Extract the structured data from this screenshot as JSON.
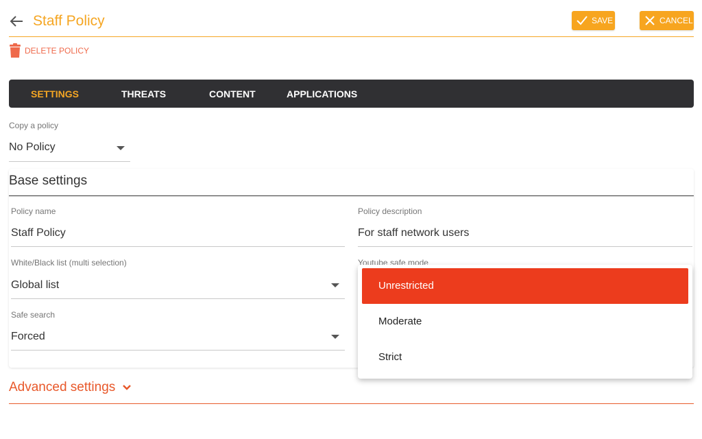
{
  "header": {
    "title": "Staff Policy",
    "save_label": "SAVE",
    "cancel_label": "CANCEL",
    "back_icon": "arrow-left-icon"
  },
  "actions": {
    "delete_label": "DELETE POLICY",
    "delete_icon": "trash-icon"
  },
  "tabs": [
    {
      "label": "SETTINGS",
      "active": true
    },
    {
      "label": "THREATS",
      "active": false
    },
    {
      "label": "CONTENT",
      "active": false
    },
    {
      "label": "APPLICATIONS",
      "active": false
    }
  ],
  "copy_policy": {
    "label": "Copy a policy",
    "value": "No Policy"
  },
  "base_settings": {
    "title": "Base settings",
    "policy_name": {
      "label": "Policy name",
      "value": "Staff Policy"
    },
    "policy_description": {
      "label": "Policy description",
      "value": "For staff network users"
    },
    "white_black_list": {
      "label": "White/Black list (multi selection)",
      "value": "Global list"
    },
    "youtube_safe_mode": {
      "label": "Youtube safe mode",
      "value": "Unrestricted"
    },
    "safe_search": {
      "label": "Safe search",
      "value": "Forced"
    }
  },
  "advanced_settings": {
    "label": "Advanced settings",
    "icon": "chevron-down-icon"
  },
  "youtube_dropdown": {
    "options": [
      "Unrestricted",
      "Moderate",
      "Strict"
    ],
    "selected": "Unrestricted"
  },
  "colors": {
    "accent": "#f5a623",
    "tab_bar": "#303033",
    "danger": "#ec3c1d",
    "delete_text": "#ef6a4b"
  }
}
